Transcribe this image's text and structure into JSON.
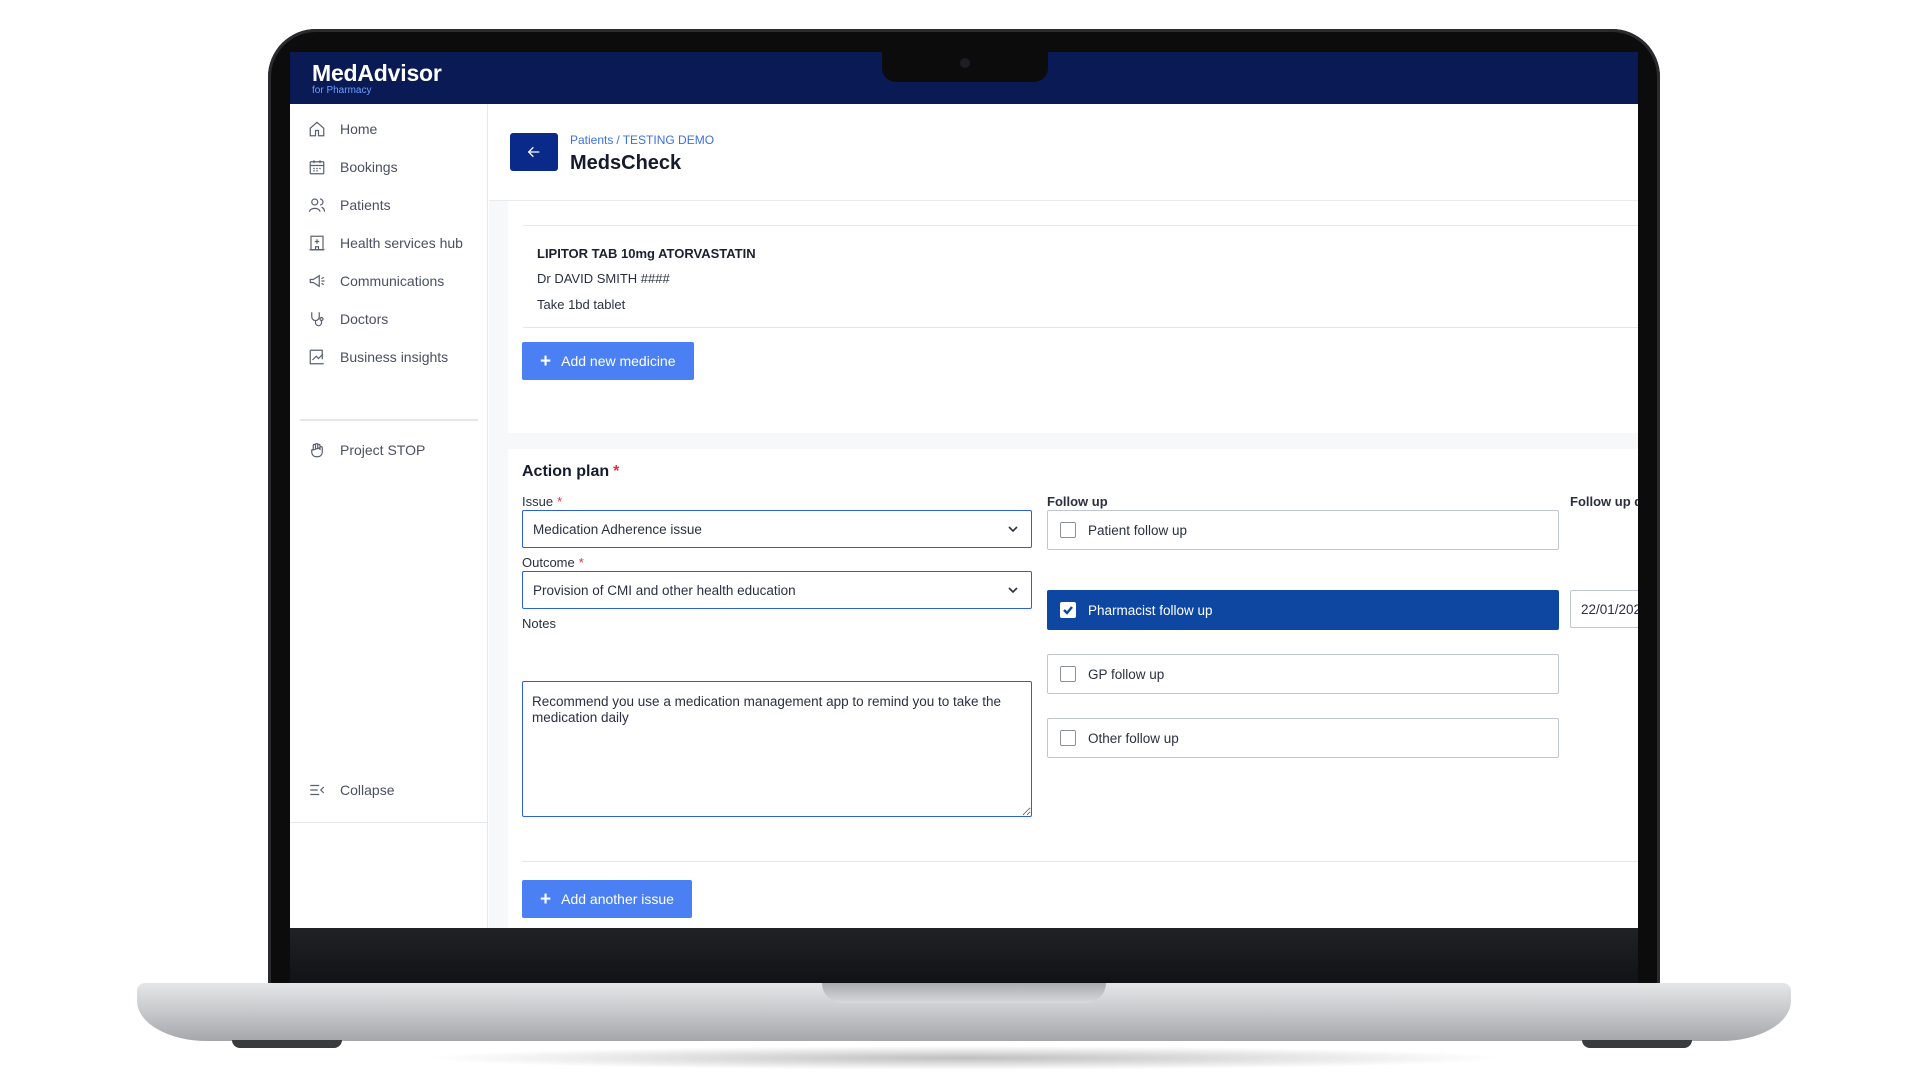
{
  "app": {
    "brand": "MedAdvisor",
    "brand_sub": "for Pharmacy"
  },
  "sidebar": {
    "items": [
      {
        "label": "Home",
        "icon": "home-icon"
      },
      {
        "label": "Bookings",
        "icon": "calendar-icon"
      },
      {
        "label": "Patients",
        "icon": "users-icon"
      },
      {
        "label": "Health services hub",
        "icon": "hospital-icon"
      },
      {
        "label": "Communications",
        "icon": "megaphone-icon"
      },
      {
        "label": "Doctors",
        "icon": "stethoscope-icon"
      },
      {
        "label": "Business insights",
        "icon": "chart-icon"
      }
    ],
    "project": {
      "label": "Project STOP",
      "icon": "hand-icon"
    },
    "collapse": {
      "label": "Collapse",
      "icon": "collapse-icon"
    }
  },
  "header": {
    "breadcrumb": [
      "Patients",
      "TESTING DEMO"
    ],
    "title": "MedsCheck"
  },
  "medicine": {
    "name": "LIPITOR TAB 10mg ATORVASTATIN",
    "doctor": "Dr DAVID SMITH ####",
    "instructions": "Take 1bd tablet",
    "add_label": "Add new medicine"
  },
  "action_plan": {
    "title": "Action plan",
    "issue_label": "Issue",
    "issue_value": "Medication Adherence issue",
    "outcome_label": "Outcome",
    "outcome_value": "Provision of CMI and other health education",
    "notes_label": "Notes",
    "notes_value": "Recommend you use a medication management app to remind you to take the medication daily",
    "follow_up_label": "Follow up",
    "follow_up_date_label": "Follow up d",
    "follow_up_options": [
      {
        "label": "Patient follow up",
        "checked": false
      },
      {
        "label": "Pharmacist follow up",
        "checked": true
      },
      {
        "label": "GP follow up",
        "checked": false
      },
      {
        "label": "Other follow up",
        "checked": false
      }
    ],
    "follow_up_date": "22/01/202",
    "add_issue_label": "Add another issue"
  },
  "colors": {
    "topbar": "#0a1a54",
    "primary_button": "#4a80f3",
    "selected": "#0e47a1",
    "required": "#e0313a"
  }
}
